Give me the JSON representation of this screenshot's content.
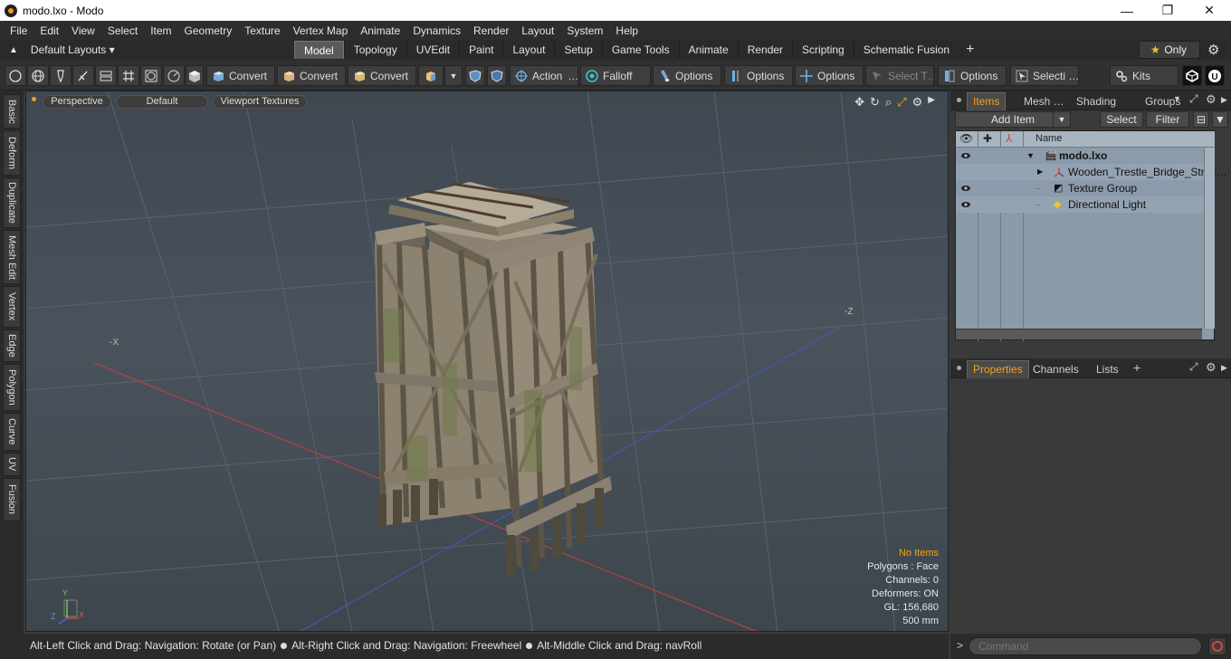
{
  "window": {
    "title": "modo.lxo - Modo",
    "minimize": "—",
    "maximize": "❐",
    "close": "✕"
  },
  "menu": [
    "File",
    "Edit",
    "View",
    "Select",
    "Item",
    "Geometry",
    "Texture",
    "Vertex Map",
    "Animate",
    "Dynamics",
    "Render",
    "Layout",
    "System",
    "Help"
  ],
  "layouts": {
    "label": "Default Layouts ▾"
  },
  "tabs": [
    "Model",
    "Topology",
    "UVEdit",
    "Paint",
    "Layout",
    "Setup",
    "Game Tools",
    "Animate",
    "Render",
    "Scripting",
    "Schematic Fusion"
  ],
  "active_tab": "Model",
  "tab_add": "+",
  "only": {
    "star": "★",
    "label": "Only"
  },
  "toolbar": {
    "convert1": "Convert",
    "convert2": "Convert",
    "convert3": "Convert",
    "action": "Action",
    "action_more": "…",
    "falloff": "Falloff",
    "options1": "Options",
    "options2": "Options",
    "options3": "Options",
    "options4": "Options",
    "select_t": "Select T…",
    "selecti": "Selecti …",
    "kits": "Kits"
  },
  "left_tabs": [
    "Basic",
    "Deform",
    "Duplicate",
    "Mesh Edit",
    "Vertex",
    "Edge",
    "Polygon",
    "Curve",
    "UV",
    "Fusion"
  ],
  "viewport": {
    "view": "Perspective",
    "shading": "Default",
    "textures": "Viewport Textures",
    "axis_x_neg": "-X",
    "axis_z_neg": "-Z",
    "hud": {
      "selection": "No Items",
      "polygons": "Polygons : Face",
      "channels": "Channels: 0",
      "deformers": "Deformers: ON",
      "gl": "GL: 156,680",
      "scale": "500 mm"
    },
    "gizmo": {
      "y": "Y",
      "z": "Z",
      "x": "X"
    }
  },
  "status": {
    "hint1": "Alt-Left Click and Drag: Navigation: Rotate (or Pan)",
    "hint2": "Alt-Right Click and Drag: Navigation: Freewheel",
    "hint3": "Alt-Middle Click and Drag: navRoll"
  },
  "right_panel": {
    "top_tabs": [
      "Items",
      "Mesh …",
      "Shading",
      "Groups"
    ],
    "add_item": "Add Item",
    "select": "Select",
    "filter": "Filter",
    "column_name": "Name",
    "items": [
      {
        "name": "modo.lxo",
        "bold": true
      },
      {
        "name": "Wooden_Trestle_Bridge_Struc…",
        "bold": false
      },
      {
        "name": "Texture Group",
        "bold": false
      },
      {
        "name": "Directional Light",
        "bold": false
      }
    ],
    "bottom_tabs": [
      "Properties",
      "Channels",
      "Lists"
    ],
    "bottom_add": "+",
    "command_placeholder": "Command",
    "command_prompt": ">"
  },
  "colors": {
    "accent": "#f6a11b",
    "viewport_bg": "#454e56",
    "list_bg": "#8a9aa8"
  }
}
